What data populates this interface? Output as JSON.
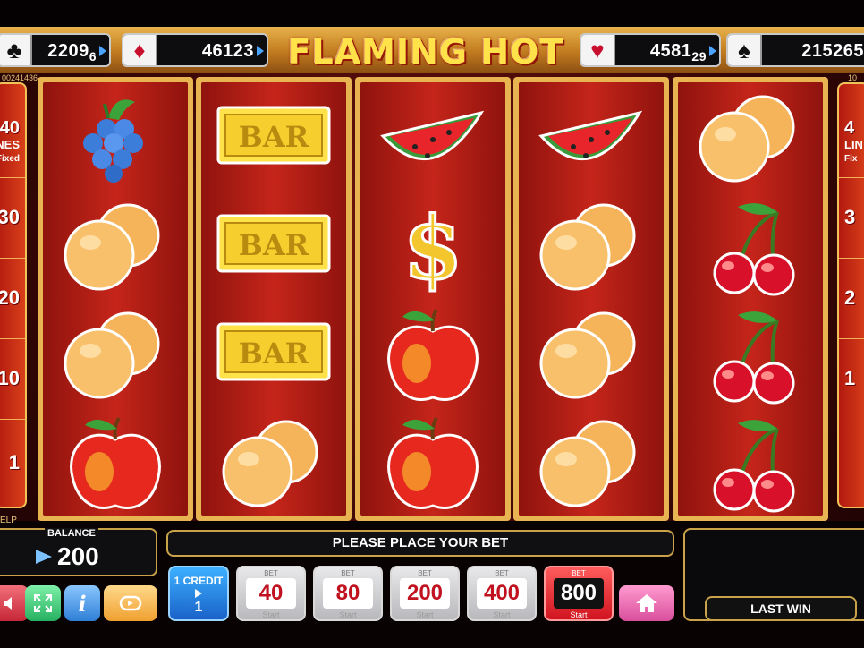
{
  "game": {
    "title": "FLAMING HOT"
  },
  "jackpots": [
    {
      "suit": "club",
      "glyph": "♣",
      "value": "2209",
      "cents": "6"
    },
    {
      "suit": "diamond",
      "glyph": "♦",
      "value": "46123",
      "cents": ""
    },
    {
      "suit": "heart",
      "glyph": "♥",
      "value": "4581",
      "cents": "29"
    },
    {
      "suit": "spade",
      "glyph": "♠",
      "value": "215265",
      "cents": ""
    }
  ],
  "codes": {
    "left": "00241436",
    "right": "10"
  },
  "side_panel": {
    "lines_number": "40",
    "lines_label": "LINES",
    "fixed_label": "Fixed",
    "left_markers": [
      "30",
      "20",
      "10",
      "1"
    ],
    "right_markers": [
      "3",
      "2",
      "1"
    ],
    "left_lines_number": "40",
    "right_lines_number": "4",
    "right_lines_label": "LIN",
    "right_fixed_label": "Fix"
  },
  "reels": [
    [
      "grape",
      "orange",
      "orange",
      "apple"
    ],
    [
      "bar",
      "bar",
      "bar",
      "orange"
    ],
    [
      "watermelon",
      "dollar",
      "apple",
      "apple"
    ],
    [
      "watermelon",
      "orange",
      "orange",
      "orange"
    ],
    [
      "orange",
      "cherry",
      "cherry",
      "cherry"
    ]
  ],
  "symbol_text": {
    "bar": "BAR",
    "dollar": "$"
  },
  "message": "PLEASE PLACE YOUR BET",
  "balance": {
    "label": "BALANCE",
    "value": "200"
  },
  "help_label": "ELP",
  "buttons": {
    "info_glyph": "i",
    "credit_line1": "1 CREDIT",
    "credit_value": "1"
  },
  "bets": [
    {
      "label": "BET",
      "value": "40",
      "start": "Start"
    },
    {
      "label": "BET",
      "value": "80",
      "start": "Start"
    },
    {
      "label": "BET",
      "value": "200",
      "start": "Start"
    },
    {
      "label": "BET",
      "value": "400",
      "start": "Start"
    },
    {
      "label": "BET",
      "value": "800",
      "start": "Start",
      "active": true
    }
  ],
  "last_win": {
    "label": "LAST WIN",
    "value": ""
  },
  "colors": {
    "reel_red": "#c5251a",
    "frame_gold": "#e8b452",
    "bet_text": "#c1121f",
    "credit_blue": "#1a62c9"
  }
}
